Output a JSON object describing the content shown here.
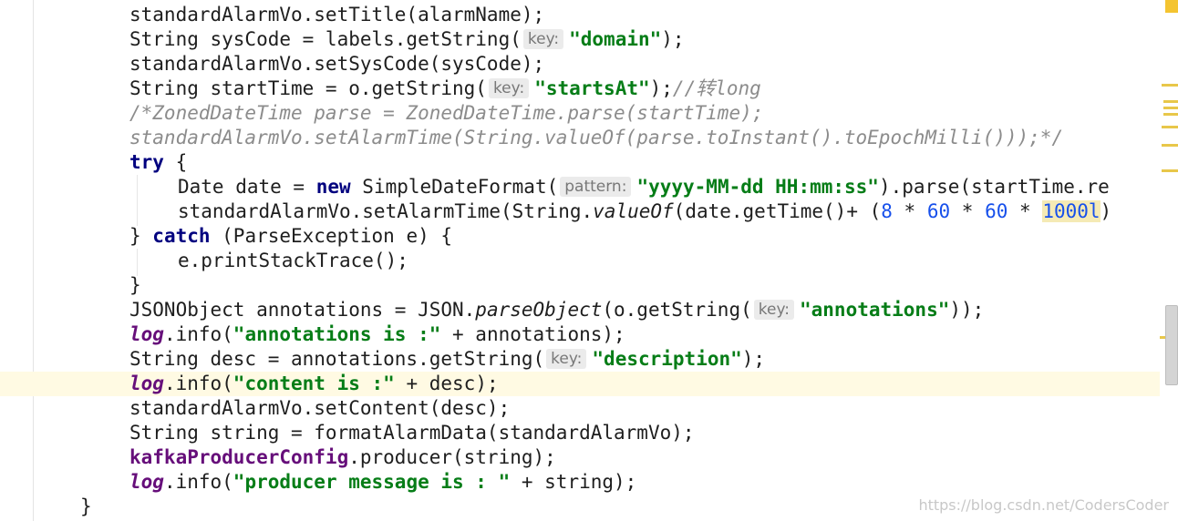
{
  "editor": {
    "lines": [
      {
        "id": "l1",
        "segments": [
          {
            "t": "standardAlarmVo.setTitle(alarmName);"
          }
        ]
      },
      {
        "id": "l2",
        "segments": [
          {
            "t": "String sysCode = labels.getString("
          },
          {
            "hint": "key:"
          },
          {
            "t": "\"domain\"",
            "c": "str"
          },
          {
            "t": ");"
          }
        ]
      },
      {
        "id": "l3",
        "segments": [
          {
            "t": "standardAlarmVo.setSysCode(sysCode);"
          }
        ]
      },
      {
        "id": "l4",
        "segments": [
          {
            "t": "String startTime = o.getString("
          },
          {
            "hint": "key:"
          },
          {
            "t": "\"startsAt\"",
            "c": "str"
          },
          {
            "t": ");"
          },
          {
            "t": "//转long",
            "c": "cmt"
          }
        ]
      },
      {
        "id": "l5",
        "segments": [
          {
            "t": "/*ZonedDateTime parse = ZonedDateTime.parse(startTime);",
            "c": "cmt"
          }
        ]
      },
      {
        "id": "l6",
        "segments": [
          {
            "t": "standardAlarmVo.setAlarmTime(String.valueOf(parse.toInstant().toEpochMilli()));*/",
            "c": "cmt"
          }
        ]
      },
      {
        "id": "l7",
        "segments": [
          {
            "t": "try",
            "c": "kw"
          },
          {
            "t": " {"
          }
        ]
      },
      {
        "id": "l8",
        "segments": [
          {
            "t": "Date date = "
          },
          {
            "t": "new",
            "c": "kw"
          },
          {
            "t": " SimpleDateFormat("
          },
          {
            "hint": "pattern:"
          },
          {
            "t": "\"yyyy-MM-dd HH:mm:ss\"",
            "c": "str"
          },
          {
            "t": ").parse(startTime.re"
          }
        ]
      },
      {
        "id": "l9",
        "segments": [
          {
            "t": "standardAlarmVo.setAlarmTime(String."
          },
          {
            "t": "valueOf",
            "c": "stat"
          },
          {
            "t": "(date.getTime()+ ("
          },
          {
            "t": "8",
            "c": "num"
          },
          {
            "t": " * "
          },
          {
            "t": "60",
            "c": "num"
          },
          {
            "t": " * "
          },
          {
            "t": "60",
            "c": "num"
          },
          {
            "t": " * "
          },
          {
            "t": "1000l",
            "c": "num-hl"
          },
          {
            "t": ")"
          }
        ]
      },
      {
        "id": "l10",
        "segments": [
          {
            "t": "} "
          },
          {
            "t": "catch",
            "c": "kw"
          },
          {
            "t": " (ParseException e) {"
          }
        ]
      },
      {
        "id": "l11",
        "segments": [
          {
            "t": "e.printStackTrace();"
          }
        ]
      },
      {
        "id": "l12",
        "segments": [
          {
            "t": "}"
          }
        ]
      },
      {
        "id": "l13",
        "segments": [
          {
            "t": "JSONObject annotations = JSON."
          },
          {
            "t": "parseObject",
            "c": "stat"
          },
          {
            "t": "(o.getString("
          },
          {
            "hint": "key:"
          },
          {
            "t": "\"annotations\"",
            "c": "str"
          },
          {
            "t": "));"
          }
        ]
      },
      {
        "id": "l14",
        "segments": [
          {
            "t": "log",
            "c": "logf"
          },
          {
            "t": ".info("
          },
          {
            "t": "\"annotations is :\"",
            "c": "str"
          },
          {
            "t": " + annotations);"
          }
        ]
      },
      {
        "id": "l15",
        "segments": [
          {
            "t": "String desc = annotations.getString("
          },
          {
            "hint": "key:"
          },
          {
            "t": "\"description\"",
            "c": "str"
          },
          {
            "t": ");"
          }
        ]
      },
      {
        "id": "l16",
        "segments": [
          {
            "t": "log",
            "c": "logf"
          },
          {
            "t": ".info("
          },
          {
            "t": "\"content is :\"",
            "c": "str"
          },
          {
            "t": " + desc);"
          }
        ]
      },
      {
        "id": "l17",
        "segments": [
          {
            "t": "standardAlarmVo.setContent(desc);"
          }
        ]
      },
      {
        "id": "l18",
        "segments": [
          {
            "t": "String string = formatAlarmData(standardAlarmVo);"
          }
        ]
      },
      {
        "id": "l19",
        "segments": [
          {
            "t": "kafkaProducerConfig",
            "c": "field"
          },
          {
            "t": ".producer(string);"
          }
        ]
      },
      {
        "id": "l20",
        "segments": [
          {
            "t": "log",
            "c": "logf"
          },
          {
            "t": ".info("
          },
          {
            "t": "\"producer message is : \"",
            "c": "str"
          },
          {
            "t": " + string);"
          }
        ]
      },
      {
        "id": "l21",
        "segments": [
          {
            "t": "}"
          }
        ]
      }
    ]
  },
  "scrollbar": {
    "warning_color": "#f4c430",
    "stripe_color": "#e8c74a"
  },
  "watermark": "https://blog.csdn.net/CodersCoder"
}
